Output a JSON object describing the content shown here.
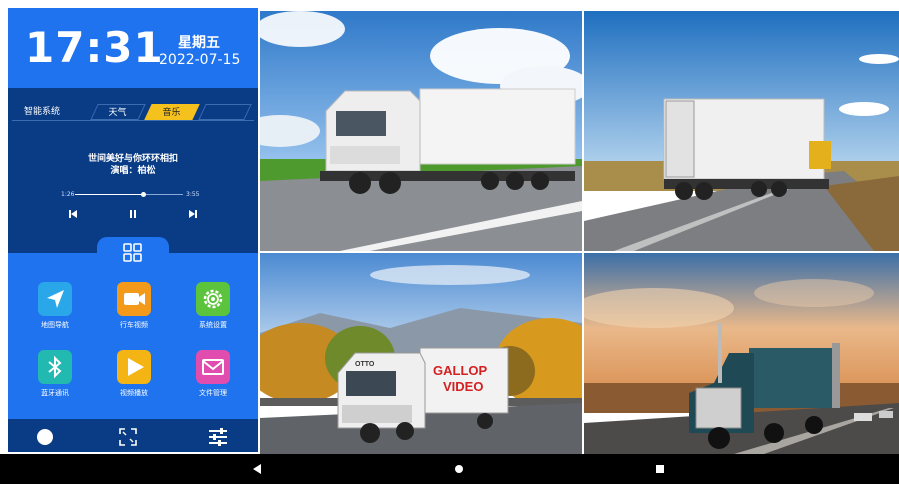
{
  "clock": {
    "time": "17:31",
    "weekday": "星期五",
    "date": "2022-07-15"
  },
  "music": {
    "tabs": [
      "智能系统",
      "天气",
      "音乐",
      ""
    ],
    "active_tab": "音乐",
    "song": "世间美好与你环环相扣",
    "singer": "演唱：柏松",
    "elapsed": "1:26",
    "duration": "3:55",
    "progress": 0.63
  },
  "apps": [
    {
      "label": "地图导航",
      "icon": "navigation-arrow-icon",
      "color": "#2aa7e8"
    },
    {
      "label": "行车视频",
      "icon": "camera-icon",
      "color": "#f39a1a"
    },
    {
      "label": "系统设置",
      "icon": "gear-icon",
      "color": "#5cc43c"
    },
    {
      "label": "蓝牙通讯",
      "icon": "bluetooth-icon",
      "color": "#21b9b0"
    },
    {
      "label": "视频播放",
      "icon": "play-icon",
      "color": "#f4b514"
    },
    {
      "label": "文件管理",
      "icon": "mail-icon",
      "color": "#e04dae"
    }
  ],
  "bottom_bar": [
    "home-dot-icon",
    "fullscreen-icon",
    "adjust-sliders-icon"
  ],
  "cameras": [
    {
      "id": "cam1",
      "scene": "white-truck-highway"
    },
    {
      "id": "cam2",
      "scene": "white-box-truck-rear"
    },
    {
      "id": "cam3",
      "scene": "volvo-truck-autumn",
      "sign": "GALLOP\nVIDEO",
      "sign_line1": "GALLOP",
      "sign_line2": "VIDEO"
    },
    {
      "id": "cam4",
      "scene": "semi-truck-sunset"
    }
  ],
  "colors": {
    "panel_dark": "#0a3c86",
    "panel_blue": "#1f73ee",
    "accent": "#f4c11d"
  }
}
